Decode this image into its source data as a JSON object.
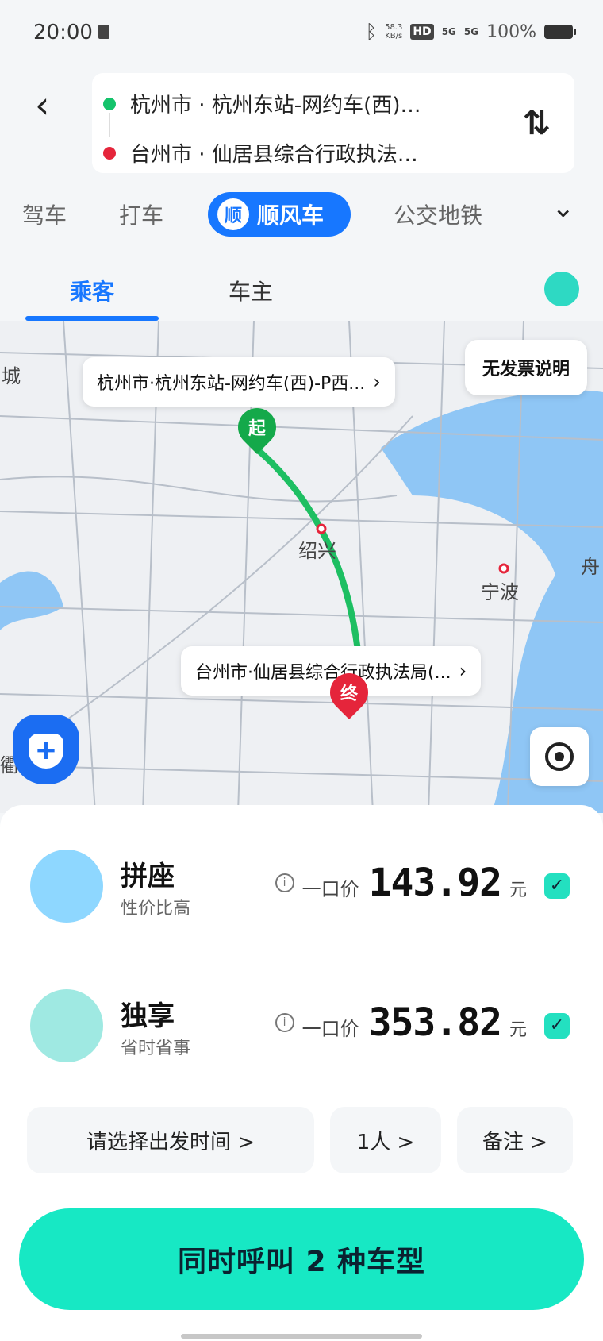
{
  "status_bar": {
    "time": "20:00",
    "speed_value": "58.3",
    "speed_unit": "KB/s",
    "hd": "HD",
    "signal1": "5G",
    "signal2": "5G",
    "battery": "100%"
  },
  "route": {
    "from": "杭州市 · 杭州东站-网约车(西)…",
    "to": "台州市 · 仙居县综合行政执法…",
    "from_color": "#14c36b",
    "to_color": "#e5253b",
    "swap_icon": "⇅"
  },
  "modes": {
    "items": [
      "驾车",
      "打车",
      "公交地铁"
    ],
    "active_badge": "顺",
    "active_label": "顺风车"
  },
  "tabs": {
    "passenger": "乘客",
    "driver": "车主"
  },
  "map": {
    "start_chip": "杭州市·杭州东站-网约车(西)-P西...",
    "end_chip": "台州市·仙居县综合行政执法局(...",
    "invoice_button": "无发票说明",
    "start_pin": "起",
    "end_pin": "终",
    "cities": {
      "shaoxing": "绍兴",
      "ningbo": "宁波",
      "left_edge": "城",
      "right_edge": "舟",
      "left_bottom": "衢"
    },
    "route_color": "#1dbf62"
  },
  "options": [
    {
      "name": "拼座",
      "subtitle": "性价比高",
      "price_label": "一口价",
      "price": "143.92",
      "unit": "元",
      "checked": "✓"
    },
    {
      "name": "独享",
      "subtitle": "省时省事",
      "price_label": "一口价",
      "price": "353.82",
      "unit": "元",
      "checked": "✓"
    }
  ],
  "controls": {
    "time": "请选择出发时间 >",
    "people": "1人 >",
    "note": "备注 >"
  },
  "cta": "同时呼叫 2 种车型",
  "colors": {
    "primary": "#1777ff",
    "cta": "#17e8c4"
  }
}
